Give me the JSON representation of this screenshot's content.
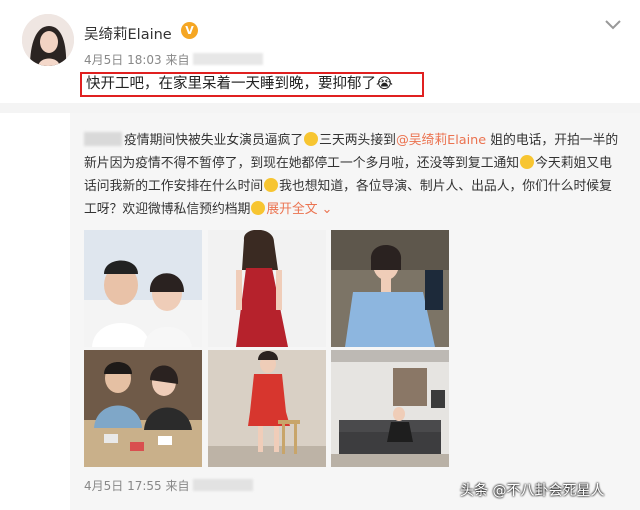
{
  "post": {
    "username": "吴绮莉Elaine",
    "verified_badge": "V",
    "date": "4月5日 18:03",
    "source_prefix": "来自",
    "text": "快开工吧，在家里呆着一天睡到晚，要抑郁了😭"
  },
  "repost": {
    "text_1": "疫情期间快被失业女演员逼疯了",
    "text_2": "三天两头接到",
    "mention": "@吴绮莉Elaine",
    "text_3": " 姐的电话，开拍一半的新片因为疫情不得不暂停了，到现在她都停工一个多月啦，还没等到复工通知",
    "text_4": "今天莉姐又电话问我新的工作安排在什么时间",
    "text_5": "我也想知道，各位导演、制片人、出品人，你们什么时候复工呀？欢迎微博私信预约档期",
    "more_label": "展开全文",
    "more_chevron": "⌄",
    "date": "4月5日 17:55",
    "source_prefix": "来自"
  },
  "photos": [
    {
      "name": "photo-couple-selfie",
      "colors": [
        "#dde4ec",
        "#f3f3f3"
      ]
    },
    {
      "name": "photo-red-dress",
      "colors": [
        "#f1f1f1",
        "#b9242d"
      ]
    },
    {
      "name": "photo-blue-dress",
      "colors": [
        "#6e6558",
        "#8db6df"
      ]
    },
    {
      "name": "photo-family-table",
      "colors": [
        "#8a6a4a",
        "#c9b08a"
      ]
    },
    {
      "name": "photo-red-outfit-stool",
      "colors": [
        "#d8cfc4",
        "#d7362e"
      ]
    },
    {
      "name": "photo-living-room",
      "colors": [
        "#e4e2df",
        "#3d3d3f"
      ]
    }
  ],
  "watermark": "头条 @不八卦会死星人",
  "colors": {
    "highlight_border": "#e02020",
    "mention": "#eb7350",
    "badge": "#f5a623"
  }
}
